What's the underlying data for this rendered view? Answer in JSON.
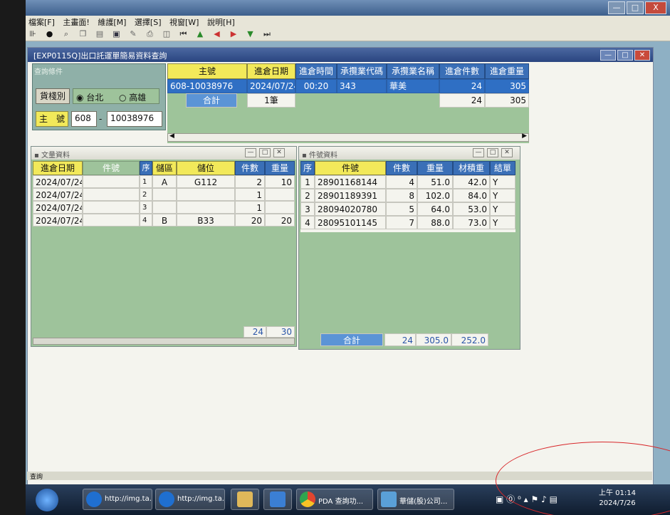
{
  "window": {
    "title": "",
    "min": "—",
    "max": "□",
    "close": "X"
  },
  "menu": [
    "檔案[F]",
    "主畫面!",
    "維護[M]",
    "選擇[S]",
    "視窗[W]",
    "說明[H]"
  ],
  "toolbar_icons": [
    "exit-icon",
    "record-icon",
    "search-icon",
    "copy-icon",
    "print-setup-icon",
    "save-icon",
    "edit-icon",
    "print-icon",
    "preview-icon",
    "first-icon",
    "prev-icon",
    "back-icon",
    "next-icon",
    "last-icon",
    "end-icon"
  ],
  "mdi": {
    "title": "[EXP0115Q]出口託運單簡易資料查詢"
  },
  "query": {
    "title": "查詢條件",
    "warehouse_btn": "貨棧別",
    "opt_taipei": "台北",
    "opt_kaohsiung": "高雄",
    "master_label": "主　號",
    "master_prefix": "608",
    "master_dash": "-",
    "master_no": "10038976"
  },
  "main_grid": {
    "headers": [
      "主號",
      "進倉日期",
      "進倉時間",
      "承攬業代碼",
      "承攬業名稱",
      "進倉件數",
      "進倉重量"
    ],
    "row": [
      "608-10038976",
      "2024/07/24",
      "00:20",
      "343",
      "華美",
      "24",
      "305"
    ],
    "sum_label": "合計",
    "sum_count": "1筆",
    "sum_pieces": "24",
    "sum_weight": "305"
  },
  "left_sub": {
    "title": "文量資料",
    "headers": [
      "進倉日期",
      "件號",
      "序",
      "儲區",
      "儲位",
      "件數",
      "重量"
    ],
    "rows": [
      [
        "2024/07/24",
        "",
        "1",
        "A",
        "G112",
        "2",
        "10"
      ],
      [
        "2024/07/24",
        "",
        "2",
        "",
        "",
        "1",
        ""
      ],
      [
        "2024/07/24",
        "",
        "3",
        "",
        "",
        "1",
        ""
      ],
      [
        "2024/07/24",
        "",
        "4",
        "B",
        "B33",
        "20",
        "20"
      ]
    ],
    "total_pieces": "24",
    "total_weight": "30"
  },
  "right_sub": {
    "title": "件號資料",
    "headers": [
      "序",
      "件號",
      "件數",
      "重量",
      "材積重",
      "結單"
    ],
    "rows": [
      [
        "1",
        "28901168144",
        "4",
        "51.0",
        "42.0",
        "Y"
      ],
      [
        "2",
        "28901189391",
        "8",
        "102.0",
        "84.0",
        "Y"
      ],
      [
        "3",
        "28094020780",
        "5",
        "64.0",
        "53.0",
        "Y"
      ],
      [
        "4",
        "28095101145",
        "7",
        "88.0",
        "73.0",
        "Y"
      ]
    ],
    "sum_label": "合計",
    "sum_pieces": "24",
    "sum_weight": "305.0",
    "sum_vol": "252.0"
  },
  "status_text": "查詢",
  "taskbar": {
    "items": [
      {
        "label": "http://img.ta...",
        "color": "#1f6fd0"
      },
      {
        "label": "http://img.ta...",
        "color": "#1f6fd0"
      },
      {
        "label": "",
        "color": "#e0b85a"
      },
      {
        "label": "",
        "color": "#3b7fd4"
      },
      {
        "label": "PDA 查詢功...",
        "color": "#e2452f"
      },
      {
        "label": "華儲(股)公司...",
        "color": "#5aa0d8"
      }
    ],
    "time": "上午 01:14",
    "date": "2024/7/26"
  },
  "colors": {
    "accent": "#2f6fc4",
    "header_yellow": "#f2e95a",
    "panel_green": "#9ec39b",
    "annotation_red": "#d8282b"
  }
}
